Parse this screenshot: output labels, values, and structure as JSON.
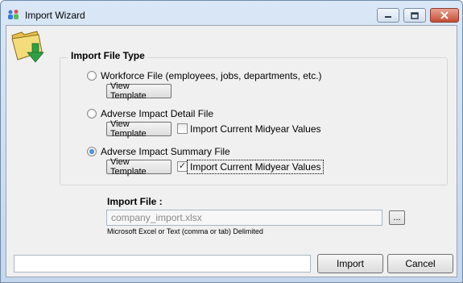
{
  "window": {
    "title": "Import Wizard",
    "app_icon": "people-icon",
    "controls": {
      "minimize": "minimize-icon",
      "maximize": "maximize-icon",
      "close": "close-icon"
    }
  },
  "header_icon": "folder-import-icon",
  "group": {
    "title": "Import File Type",
    "options": [
      {
        "label": "Workforce File (employees, jobs, departments, etc.)",
        "selected": false,
        "template_button": "View Template"
      },
      {
        "label": "Adverse Impact Detail File",
        "selected": false,
        "template_button": "View Template",
        "checkbox_label": "Import Current Midyear Values",
        "checked": false
      },
      {
        "label": "Adverse Impact Summary File",
        "selected": true,
        "template_button": "View Template",
        "checkbox_label": "Import Current Midyear Values",
        "checked": true
      }
    ]
  },
  "import_file": {
    "label": "Import File :",
    "value": "company_import.xlsx",
    "browse_label": "...",
    "hint": "Microsoft Excel or Text (comma or tab) Delimited"
  },
  "footer": {
    "status_text": "",
    "import_label": "Import",
    "cancel_label": "Cancel"
  },
  "colors": {
    "titlebar": "#c4d7ee",
    "client": "#f0f0f0",
    "close": "#c54c34"
  }
}
